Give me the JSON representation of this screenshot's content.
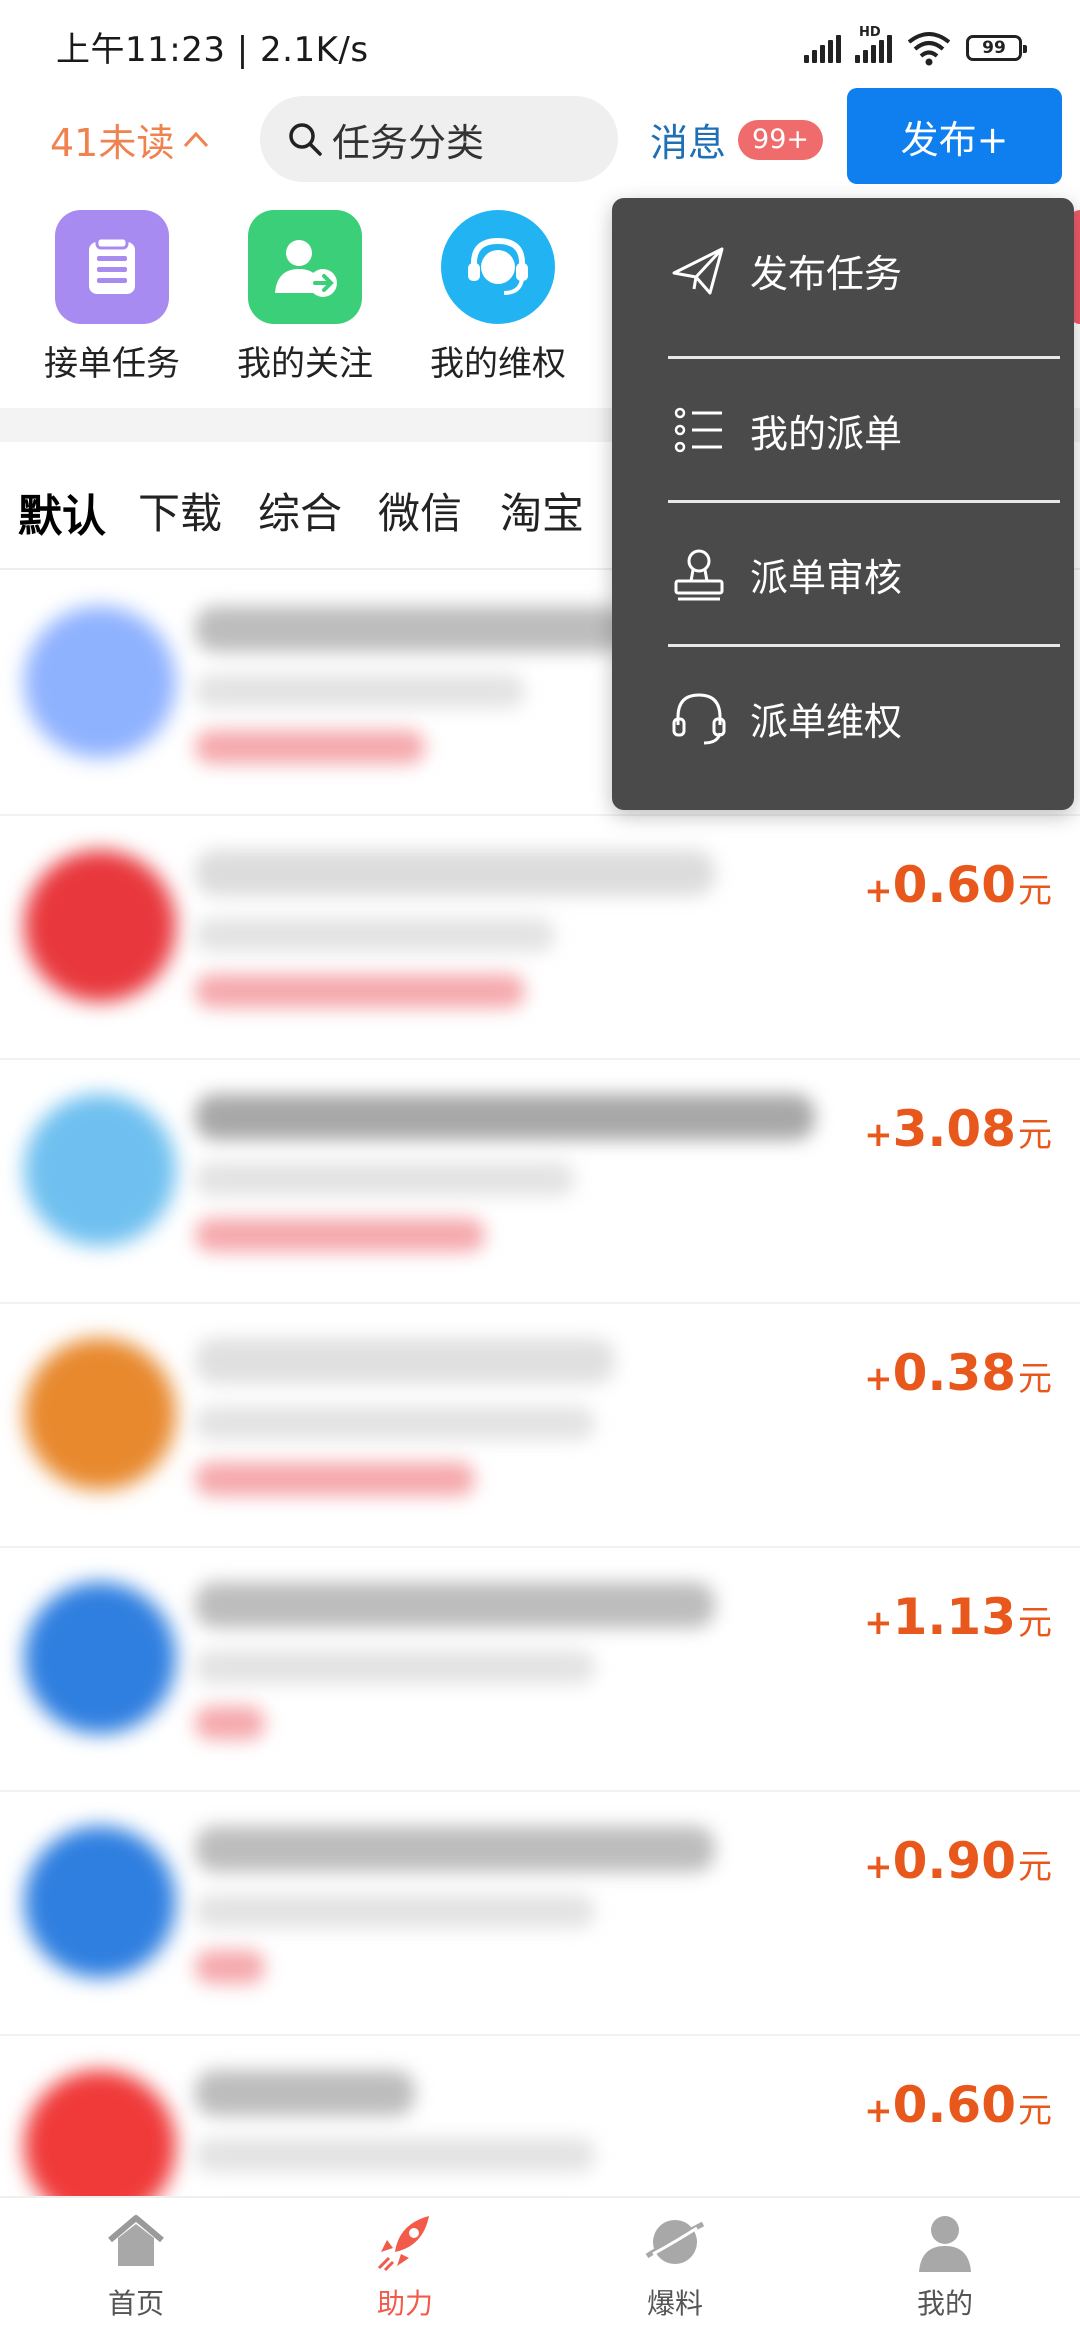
{
  "status": {
    "time_speed": "上午11:23 | 2.1K/s",
    "battery": "99",
    "hd": "HD"
  },
  "header": {
    "unread": "41未读",
    "search_placeholder": "任务分类",
    "messages_label": "消息",
    "messages_badge": "99+",
    "publish_button": "发布+"
  },
  "quick_actions": [
    {
      "label": "接单任务",
      "icon": "clipboard-icon",
      "color": "#a78bf0"
    },
    {
      "label": "我的关注",
      "icon": "user-follow-icon",
      "color": "#3ccf7a"
    },
    {
      "label": "我的维权",
      "icon": "headset-icon",
      "color": "#22b4f2"
    }
  ],
  "categories": [
    "默认",
    "下载",
    "综合",
    "微信",
    "淘宝"
  ],
  "publish_menu": [
    {
      "label": "发布任务",
      "icon": "paper-plane-icon"
    },
    {
      "label": "我的派单",
      "icon": "list-icon"
    },
    {
      "label": "派单审核",
      "icon": "stamp-icon"
    },
    {
      "label": "派单维权",
      "icon": "headset-icon"
    }
  ],
  "tasks": [
    {
      "plus": "+",
      "amount": "0.60",
      "unit": "元",
      "avatar_color": "#e8383d"
    },
    {
      "plus": "+",
      "amount": "3.08",
      "unit": "元",
      "avatar_color": "#4aa6e8"
    },
    {
      "plus": "+",
      "amount": "0.38",
      "unit": "元",
      "avatar_color": "#e8892e"
    },
    {
      "plus": "+",
      "amount": "1.13",
      "unit": "元",
      "avatar_color": "#2f7fe0"
    },
    {
      "plus": "+",
      "amount": "0.90",
      "unit": "元",
      "avatar_color": "#2f7fe0"
    },
    {
      "plus": "+",
      "amount": "0.60",
      "unit": "元",
      "avatar_color": "#f03a3a"
    }
  ],
  "bottom_nav": [
    {
      "label": "首页",
      "icon": "home-icon"
    },
    {
      "label": "助力",
      "icon": "rocket-icon",
      "active": true
    },
    {
      "label": "爆料",
      "icon": "planet-icon"
    },
    {
      "label": "我的",
      "icon": "profile-icon"
    }
  ],
  "colors": {
    "accent_blue": "#0f7ff0",
    "reward_orange": "#e8581c",
    "unread_orange": "#f0824f",
    "menu_bg": "#4a4a4a"
  }
}
